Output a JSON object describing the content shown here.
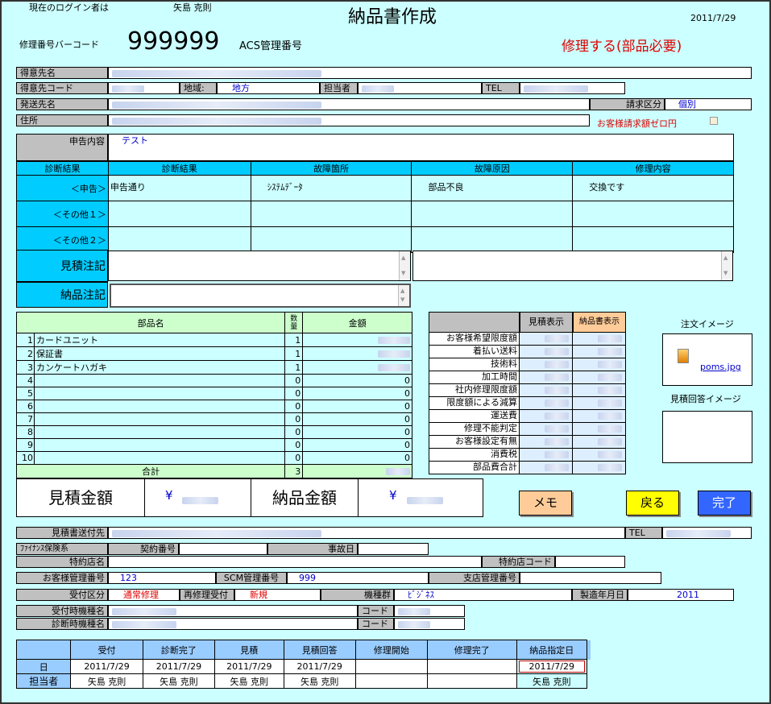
{
  "header": {
    "login_label": "現在のログイン者は",
    "login_user": "矢島 克則",
    "title": "納品書作成",
    "date": "2011/7/29",
    "barcode_label": "修理番号バーコード",
    "barcode_value": "999999",
    "acs_label": "ACS管理番号",
    "status": "修理する(部品必要)"
  },
  "customer": {
    "name_label": "得意先名",
    "code_label": "得意先コード",
    "region_label": "地域:",
    "region_value": "地方",
    "staff_label": "担当者",
    "tel_label": "TEL",
    "ship_label": "発送先名",
    "billing_label": "請求区分",
    "billing_value": "個別",
    "address_label": "住所",
    "zero_label": "お客様請求額ゼロ円"
  },
  "report": {
    "label": "申告内容",
    "value": "テスト"
  },
  "diag": {
    "headers": [
      "診断結果",
      "診断結果",
      "故障箇所",
      "故障原因",
      "修理内容"
    ],
    "rows": [
      {
        "label": "＜申告＞",
        "result": "申告通り",
        "location": "ｼｽﾃﾑﾃﾞｰﾀ",
        "cause": "部品不良",
        "repair": "交換です"
      },
      {
        "label": "＜その他１＞",
        "result": "",
        "location": "",
        "cause": "",
        "repair": ""
      },
      {
        "label": "＜その他２＞",
        "result": "",
        "location": "",
        "cause": "",
        "repair": ""
      }
    ],
    "estimate_note_label": "見積注記",
    "delivery_note_label": "納品注記"
  },
  "parts": {
    "header_name": "部品名",
    "header_qty": "数量",
    "header_amount": "金額",
    "rows": [
      {
        "no": "1",
        "name": "カードユニット",
        "qty": "1",
        "amount": ""
      },
      {
        "no": "2",
        "name": "保証書",
        "qty": "1",
        "amount": ""
      },
      {
        "no": "3",
        "name": "カンケートハガキ",
        "qty": "1",
        "amount": ""
      },
      {
        "no": "4",
        "name": "",
        "qty": "0",
        "amount": "0"
      },
      {
        "no": "5",
        "name": "",
        "qty": "0",
        "amount": "0"
      },
      {
        "no": "6",
        "name": "",
        "qty": "0",
        "amount": "0"
      },
      {
        "no": "7",
        "name": "",
        "qty": "0",
        "amount": "0"
      },
      {
        "no": "8",
        "name": "",
        "qty": "0",
        "amount": "0"
      },
      {
        "no": "9",
        "name": "",
        "qty": "0",
        "amount": "0"
      },
      {
        "no": "10",
        "name": "",
        "qty": "0",
        "amount": "0"
      }
    ],
    "total_label": "合計",
    "total_qty": "3"
  },
  "fees": {
    "estimate_btn": "見積表示",
    "delivery_btn": "納品書表示",
    "rows": [
      "お客様希望限度額",
      "着払い送料",
      "技術料",
      "加工時間",
      "社内修理限度額",
      "限度額による減算",
      "運送費",
      "修理不能判定",
      "お客様設定有無",
      "消費税",
      "部品費合計"
    ]
  },
  "images": {
    "order_label": "注文イメージ",
    "order_file": "poms.jpg",
    "estimate_label": "見積回答イメージ"
  },
  "totals": {
    "estimate_label": "見積金額",
    "delivery_label": "納品金額",
    "yen": "¥"
  },
  "buttons": {
    "memo": "メモ",
    "back": "戻る",
    "done": "完了"
  },
  "lower": {
    "est_dest_label": "見積書送付先",
    "tel_label": "TEL",
    "finance_label": "ﾌｧｲﾅﾝｽ保険系",
    "contract_label": "契約番号",
    "accident_label": "事故日",
    "dealer_label": "特約店名",
    "dealer_code_label": "特約店コード",
    "cust_mgmt_label": "お客様管理番号",
    "cust_mgmt_value": "123",
    "scm_label": "SCM管理番号",
    "scm_value": "999",
    "branch_label": "支店管理番号",
    "reception_label": "受付区分",
    "reception_value": "通常修理",
    "rerepair_label": "再修理受付",
    "rerepair_value": "新規",
    "model_group_label": "機種群",
    "model_group_value": "ﾋﾞｼﾞﾈｽ",
    "mfg_label": "製造年月日",
    "mfg_value": "2011",
    "recv_model_label": "受付時機種名",
    "diag_model_label": "診断時機種名",
    "code_label": "コード"
  },
  "schedule": {
    "headers": [
      "受付",
      "診断完了",
      "見積",
      "見積回答",
      "修理開始",
      "修理完了",
      "納品指定日"
    ],
    "day_label": "日",
    "staff_label": "担当者",
    "days": [
      "2011/7/29",
      "2011/7/29",
      "2011/7/29",
      "2011/7/29",
      "",
      "",
      "2011/7/29"
    ],
    "staff": [
      "矢島 克則",
      "矢島 克則",
      "矢島 克則",
      "矢島 克則",
      "",
      "",
      "矢島 克則"
    ]
  }
}
